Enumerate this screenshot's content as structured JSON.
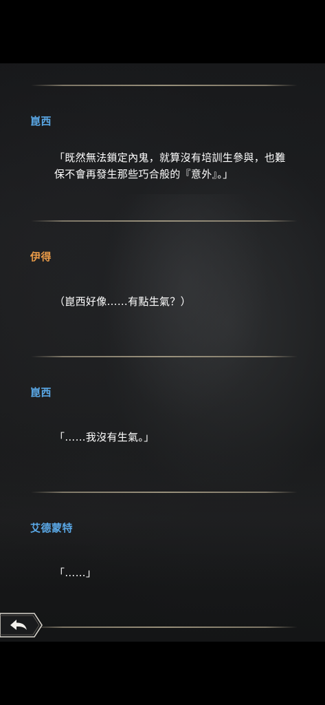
{
  "colors": {
    "speaker_blue": "#5aa8e6",
    "speaker_orange": "#e89a48",
    "dialogue_text": "#ffffff"
  },
  "dialogue_log": [
    {
      "speaker": "崑西",
      "speaker_color": "blue",
      "text": "「既然無法鎖定內鬼，就算沒有培訓生參與，也難保不會再發生那些巧合般的『意外』。」"
    },
    {
      "speaker": "伊得",
      "speaker_color": "orange",
      "text": "（崑西好像……有點生氣？）"
    },
    {
      "speaker": "崑西",
      "speaker_color": "blue",
      "text": "「……我沒有生氣。」"
    },
    {
      "speaker": "艾德蒙特",
      "speaker_color": "blue",
      "text": "「……」"
    }
  ],
  "controls": {
    "back_icon": "back-arrow-icon"
  }
}
